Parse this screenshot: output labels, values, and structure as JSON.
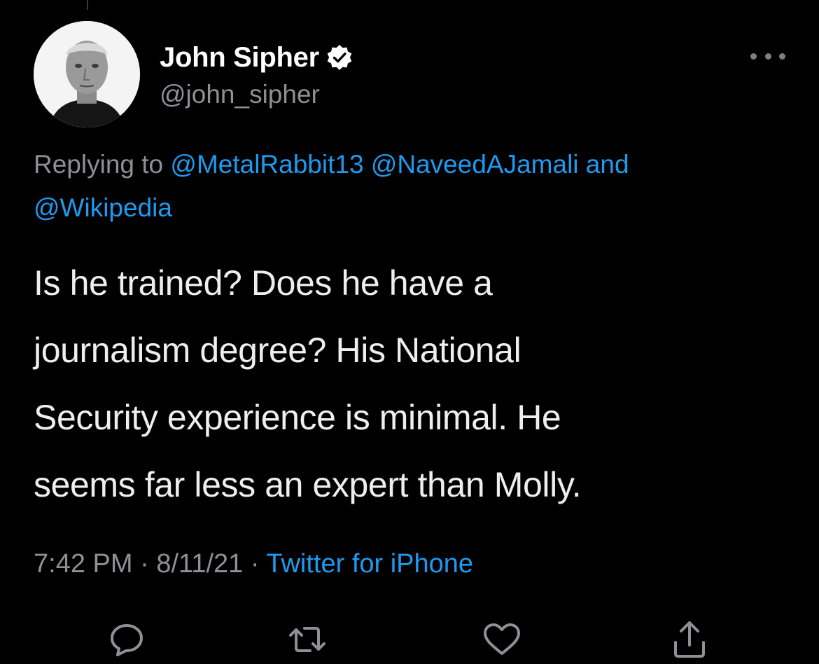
{
  "tweet": {
    "author": {
      "display_name": "John Sipher",
      "handle": "@john_sipher",
      "verified": true
    },
    "reply_context": {
      "prefix": "Replying to",
      "mentions": [
        "@MetalRabbit13",
        "@NaveedAJamali"
      ],
      "conjunction": "and",
      "last_mention": "@Wikipedia"
    },
    "text_lines": [
      "Is he trained? Does he have a",
      "journalism degree? His National",
      "Security experience is minimal. He",
      "seems far less an expert than Molly."
    ],
    "time": "7:42 PM",
    "separator": "·",
    "date": "8/11/21",
    "source": "Twitter for iPhone"
  },
  "actions": [
    {
      "name": "reply",
      "icon": "reply-icon"
    },
    {
      "name": "retweet",
      "icon": "retweet-icon"
    },
    {
      "name": "like",
      "icon": "heart-icon"
    },
    {
      "name": "share",
      "icon": "share-icon"
    }
  ],
  "colors": {
    "background": "#000000",
    "link": "#1d9bf0",
    "secondary_text": "#8e9095",
    "primary_text": "#eeeeee"
  }
}
